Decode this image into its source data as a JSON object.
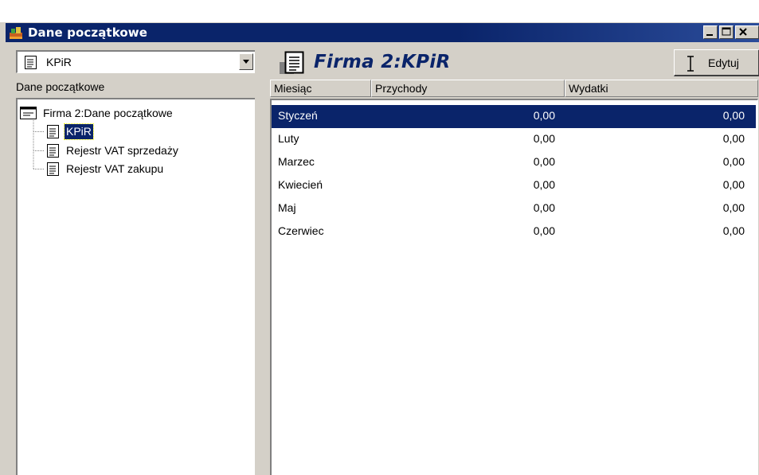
{
  "window": {
    "title": "Dane początkowe"
  },
  "left_panel": {
    "combo_value": "KPiR",
    "section_label": "Dane początkowe",
    "tree": {
      "root": "Firma 2:Dane początkowe",
      "children": [
        {
          "label": "KPiR",
          "selected": true
        },
        {
          "label": "Rejestr VAT sprzedaży",
          "selected": false
        },
        {
          "label": "Rejestr VAT zakupu",
          "selected": false
        }
      ]
    }
  },
  "right_panel": {
    "title": "Firma 2:KPiR",
    "edit_button": "Edytuj",
    "columns": [
      "Miesiąc",
      "Przychody",
      "Wydatki"
    ],
    "rows": [
      {
        "month": "Styczeń",
        "income": "0,00",
        "expenses": "0,00",
        "selected": true
      },
      {
        "month": "Luty",
        "income": "0,00",
        "expenses": "0,00",
        "selected": false
      },
      {
        "month": "Marzec",
        "income": "0,00",
        "expenses": "0,00",
        "selected": false
      },
      {
        "month": "Kwiecień",
        "income": "0,00",
        "expenses": "0,00",
        "selected": false
      },
      {
        "month": "Maj",
        "income": "0,00",
        "expenses": "0,00",
        "selected": false
      },
      {
        "month": "Czerwiec",
        "income": "0,00",
        "expenses": "0,00",
        "selected": false
      }
    ]
  },
  "colors": {
    "titlebar": "#0a246a",
    "selection": "#0a246a",
    "face": "#d4d0c8"
  }
}
